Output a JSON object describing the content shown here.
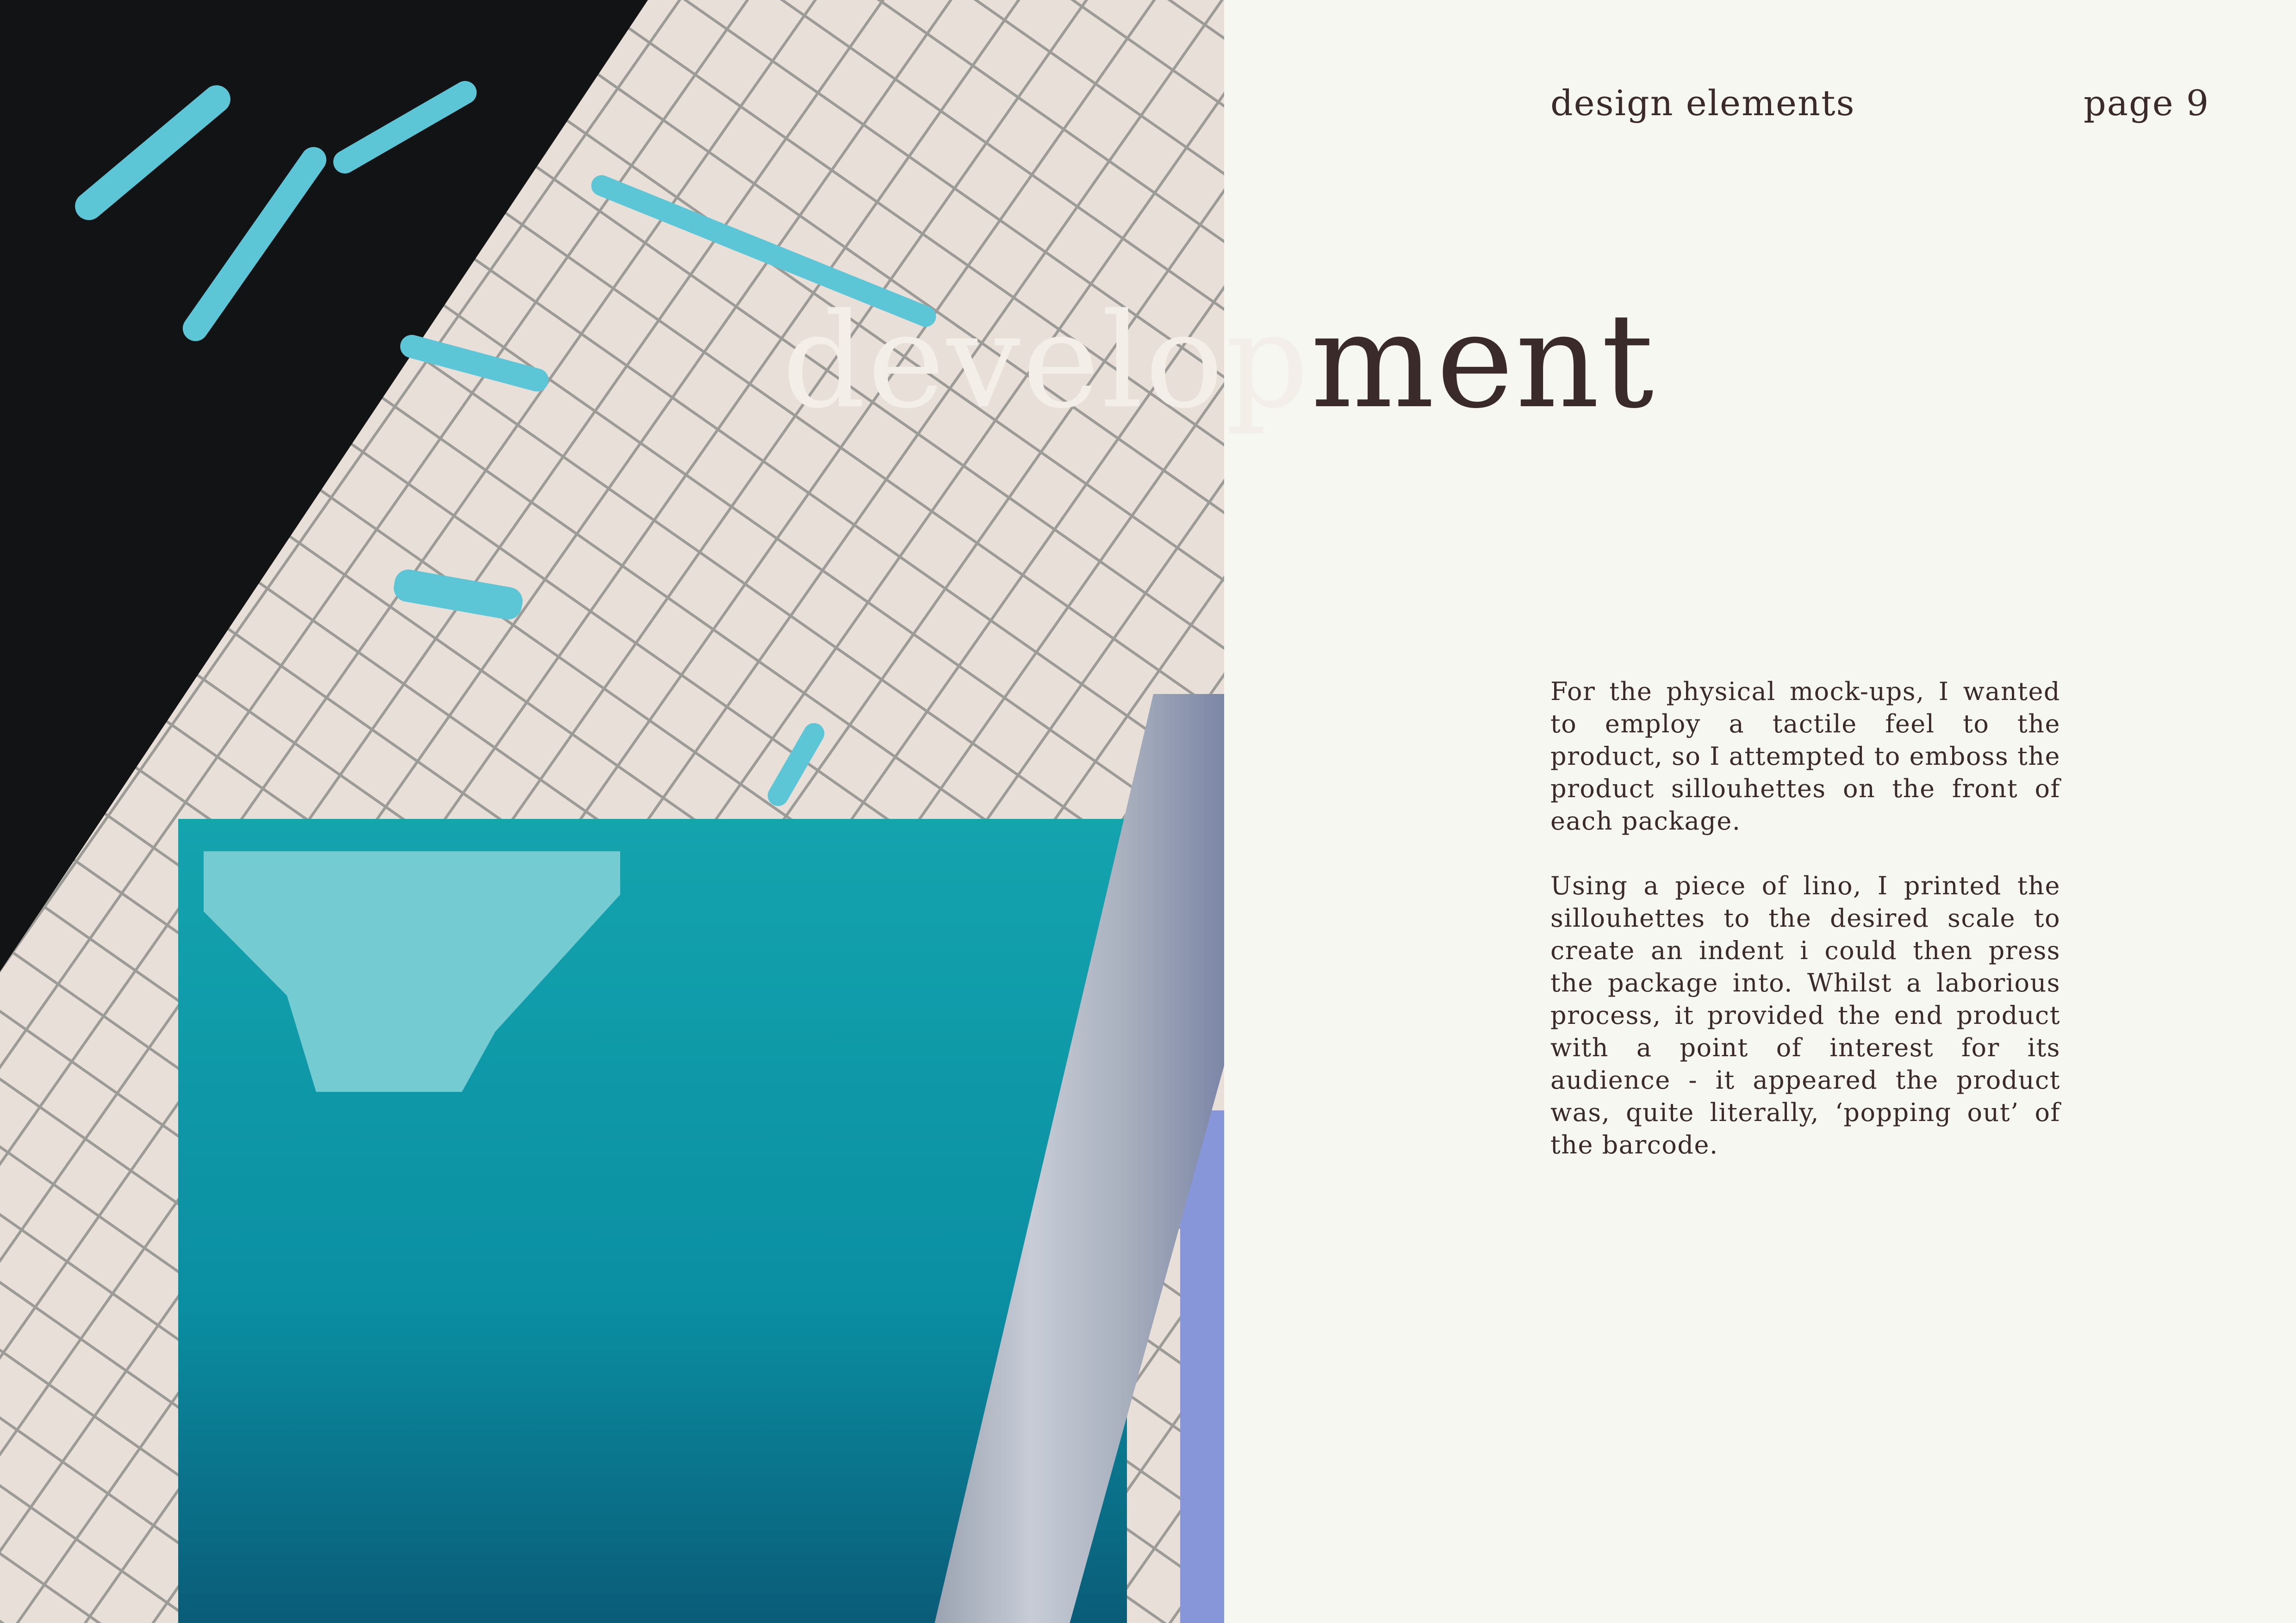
{
  "header": {
    "section": "design elements",
    "page": "page 9"
  },
  "title": {
    "part_over_photo": "develop",
    "part_on_page": "ment"
  },
  "body": {
    "paragraphs": [
      "For the physical mock-ups, I wanted to employ a tactile feel to the product, so I attempted to emboss the product sillouhettes on the front of each package.",
      "Using a piece of lino, I printed the sillouhettes to the desired scale to create an indent i could then press the package into. Whilst a laborious process, it provided the end product with a point of interest for its audience - it appeared the product was, quite literally, ‘popping out’ of the barcode."
    ]
  }
}
